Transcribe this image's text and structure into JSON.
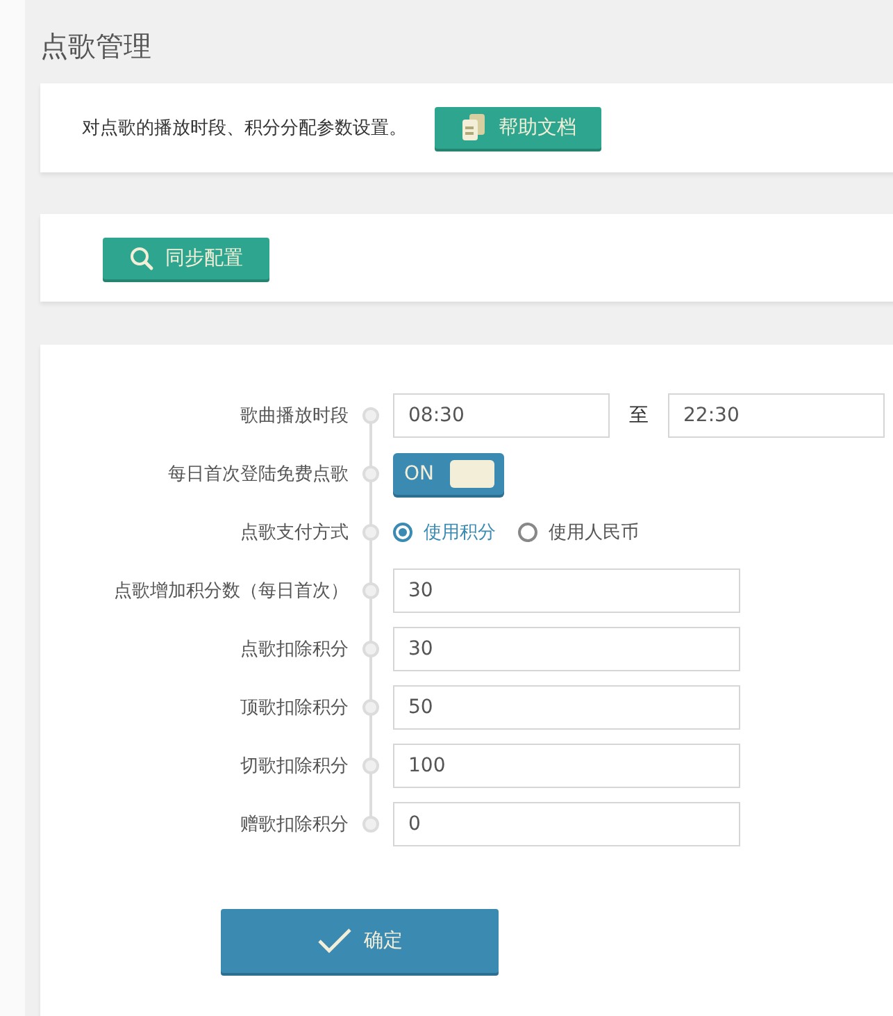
{
  "page_title": "点歌管理",
  "intro": {
    "text": "对点歌的播放时段、积分分配参数设置。",
    "help_button": "帮助文档"
  },
  "toolbar": {
    "sync_button": "同步配置"
  },
  "form": {
    "rows": [
      {
        "kind": "time_range",
        "label": "歌曲播放时段",
        "start": "08:30",
        "separator": "至",
        "end": "22:30"
      },
      {
        "kind": "toggle",
        "label": "每日首次登陆免费点歌",
        "on": true,
        "on_label": "ON"
      },
      {
        "kind": "radio",
        "label": "点歌支付方式",
        "options": [
          {
            "label": "使用积分",
            "selected": true
          },
          {
            "label": "使用人民币",
            "selected": false
          }
        ]
      },
      {
        "kind": "text",
        "label": "点歌增加积分数（每日首次）",
        "value": "30"
      },
      {
        "kind": "text",
        "label": "点歌扣除积分",
        "value": "30"
      },
      {
        "kind": "text",
        "label": "顶歌扣除积分",
        "value": "50"
      },
      {
        "kind": "text",
        "label": "切歌扣除积分",
        "value": "100"
      },
      {
        "kind": "text",
        "label": "赠歌扣除积分",
        "value": "0"
      }
    ],
    "submit_button": "确定"
  }
}
